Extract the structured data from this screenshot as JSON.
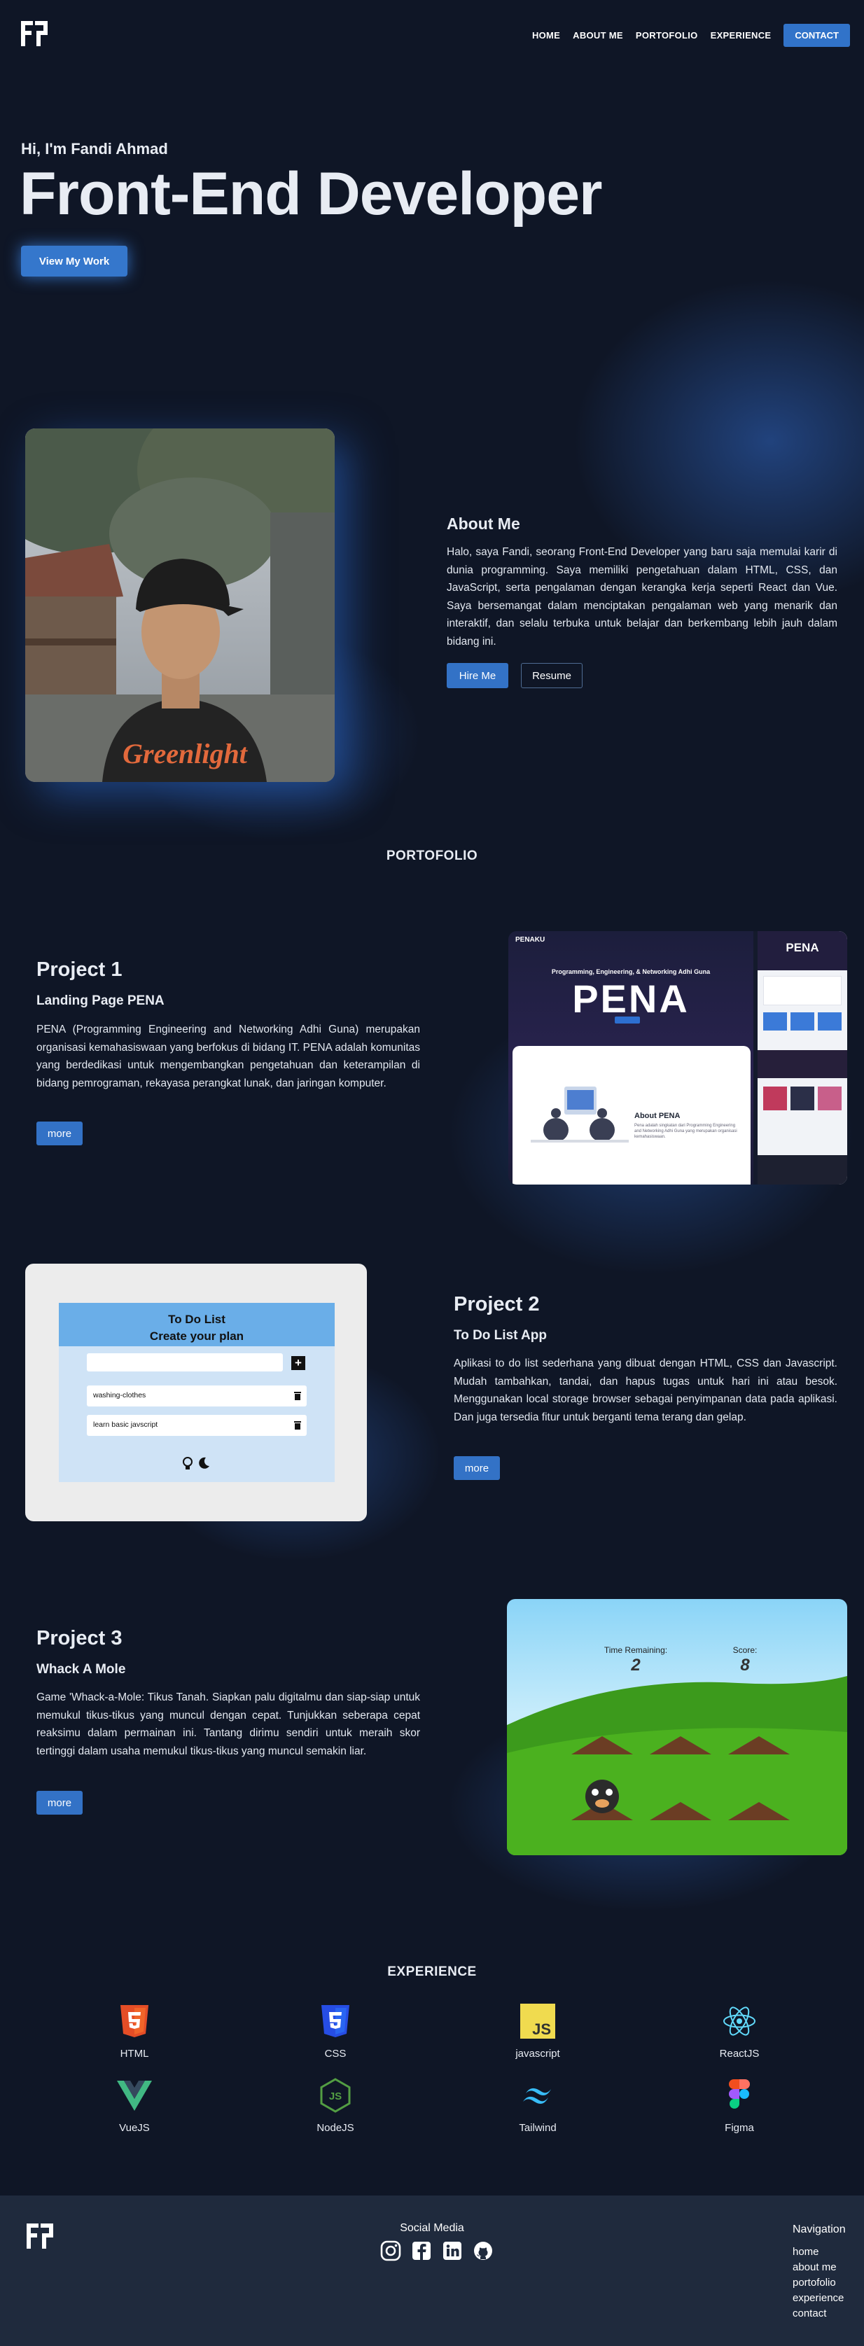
{
  "nav": {
    "logo": "logo",
    "links": [
      "HOME",
      "ABOUT ME",
      "PORTOFOLIO",
      "EXPERIENCE"
    ],
    "contact": "CONTACT"
  },
  "hero": {
    "greeting": "Hi, I'm Fandi Ahmad",
    "title": "Front-End Developer",
    "cta": "View My Work"
  },
  "about": {
    "title": "About Me",
    "text": "Halo, saya Fandi, seorang Front-End Developer yang baru saja memulai karir di dunia programming. Saya memiliki pengetahuan dalam HTML, CSS, dan JavaScript, serta pengalaman dengan kerangka kerja seperti React dan Vue. Saya bersemangat dalam menciptakan pengalaman web yang menarik dan interaktif, dan selalu terbuka untuk belajar dan berkembang lebih jauh dalam bidang ini.",
    "hire": "Hire Me",
    "resume": "Resume",
    "shirt_text": "Greenlight"
  },
  "portfolio": {
    "title": "PORTOFOLIO",
    "projects": [
      {
        "title": "Project 1",
        "subtitle": "Landing Page PENA",
        "text": "PENA (Programming Engineering and Networking Adhi Guna) merupakan organisasi kemahasiswaan yang berfokus di bidang IT. PENA adalah komunitas yang berdedikasi untuk mengembangkan pengetahuan dan keterampilan di bidang pemrograman, rekayasa perangkat lunak, dan jaringan komputer.",
        "more": "more",
        "shot": {
          "brand": "PENAKU",
          "tagline": "Programming, Engineering, & Networking Adhi Guna",
          "hero_word": "PENA",
          "side_word": "PENA",
          "about_title": "About PENA",
          "about_text": "Pena adalah singkatan dari Programming Engineering and Networking Adhi Guna yang merupakan organisasi kemahasiswaan."
        }
      },
      {
        "title": "Project 2",
        "subtitle": "To Do List App",
        "text": "Aplikasi to do list sederhana yang dibuat dengan HTML, CSS dan Javascript. Mudah tambahkan, tandai, dan hapus tugas untuk hari ini atau besok. Menggunakan local storage browser sebagai penyimpanan data pada aplikasi. Dan juga tersedia fitur untuk berganti tema terang dan gelap.",
        "more": "more",
        "app": {
          "heading": "To Do List",
          "subheading": "Create your plan",
          "add": "+",
          "tasks": [
            "washing-clothes",
            "learn basic javscript"
          ]
        }
      },
      {
        "title": "Project 3",
        "subtitle": "Whack A Mole",
        "text": "Game 'Whack-a-Mole: Tikus Tanah. Siapkan palu digitalmu dan siap-siap untuk memukul tikus-tikus yang muncul dengan cepat. Tunjukkan seberapa cepat reaksimu dalam permainan ini. Tantang dirimu sendiri untuk meraih skor tertinggi dalam usaha memukul tikus-tikus yang muncul semakin liar.",
        "more": "more",
        "game": {
          "time_label": "Time Remaining:",
          "time_value": "2",
          "score_label": "Score:",
          "score_value": "8"
        }
      }
    ]
  },
  "experience": {
    "title": "EXPERIENCE",
    "skills": [
      "HTML",
      "CSS",
      "javascript",
      "ReactJS",
      "VueJS",
      "NodeJS",
      "Tailwind",
      "Figma"
    ]
  },
  "footer": {
    "social_title": "Social Media",
    "social_icons": [
      "instagram-icon",
      "facebook-icon",
      "linkedin-icon",
      "github-icon"
    ],
    "nav_title": "Navigation",
    "nav_links": [
      "home",
      "about me",
      "portofolio",
      "experience",
      "contact"
    ]
  },
  "colors": {
    "background": "#0f1626",
    "accent": "#3372c6",
    "footer": "#1f2a3d"
  }
}
